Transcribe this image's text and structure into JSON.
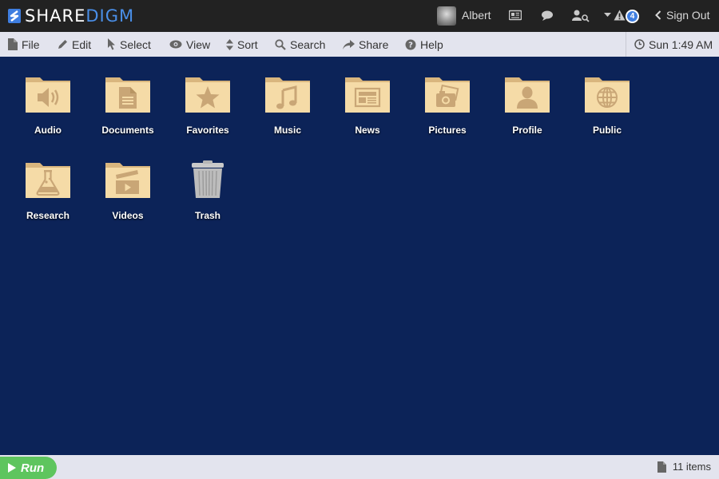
{
  "brand": {
    "share": "SHARE",
    "digm": "DIGM"
  },
  "user": {
    "name": "Albert"
  },
  "notifications": {
    "alert_count": "4"
  },
  "signout": {
    "label": "Sign Out"
  },
  "menu": {
    "file": "File",
    "edit": "Edit",
    "select": "Select",
    "view": "View",
    "sort": "Sort",
    "search": "Search",
    "share": "Share",
    "help": "Help"
  },
  "clock": {
    "time": "Sun 1:49 AM"
  },
  "desktop": {
    "items": [
      {
        "label": "Audio",
        "icon": "speaker-icon"
      },
      {
        "label": "Documents",
        "icon": "document-icon"
      },
      {
        "label": "Favorites",
        "icon": "star-icon"
      },
      {
        "label": "Music",
        "icon": "music-note-icon"
      },
      {
        "label": "News",
        "icon": "newspaper-icon"
      },
      {
        "label": "Pictures",
        "icon": "camera-icon"
      },
      {
        "label": "Profile",
        "icon": "person-icon"
      },
      {
        "label": "Public",
        "icon": "globe-icon"
      },
      {
        "label": "Research",
        "icon": "flask-icon"
      },
      {
        "label": "Videos",
        "icon": "film-icon"
      },
      {
        "label": "Trash",
        "icon": "trash-icon"
      }
    ]
  },
  "run": {
    "label": "Run"
  },
  "status": {
    "count": "11 items"
  },
  "colors": {
    "desktop_bg": "#0c2358",
    "topbar_bg": "#222222",
    "menubar_bg": "#e3e4ee",
    "folder": "#f5dba7",
    "folder_glyph": "#c9a676",
    "run_green": "#5ec55e",
    "badge_blue": "#3f7ee0",
    "brand_blue": "#4a8fe8"
  }
}
